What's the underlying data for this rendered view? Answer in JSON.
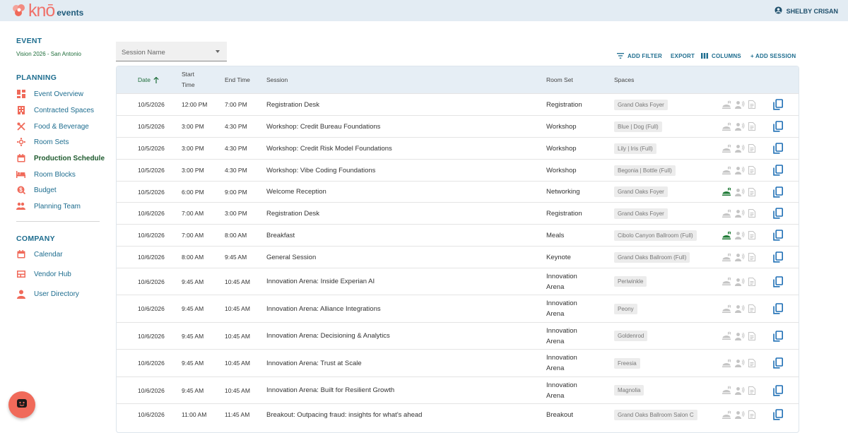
{
  "app": {
    "logo_main": "knō",
    "logo_sub": "events",
    "user_name": "SHELBY CRISAN",
    "brand_color": "#f0716a",
    "accent_color": "#1e6d8f"
  },
  "sidebar": {
    "event_title": "EVENT",
    "event_name": "Vision 2026 - San Antonio",
    "planning_title": "PLANNING",
    "planning_items": [
      {
        "label": "Event Overview",
        "icon": "dashboard-icon"
      },
      {
        "label": "Contracted Spaces",
        "icon": "building-icon"
      },
      {
        "label": "Food & Beverage",
        "icon": "utensils-icon"
      },
      {
        "label": "Room Sets",
        "icon": "room-set-icon"
      },
      {
        "label": "Production Schedule",
        "icon": "calendar-icon",
        "active": true
      },
      {
        "label": "Room Blocks",
        "icon": "bed-icon"
      },
      {
        "label": "Budget",
        "icon": "budget-icon"
      },
      {
        "label": "Planning Team",
        "icon": "team-icon"
      }
    ],
    "company_title": "COMPANY",
    "company_items": [
      {
        "label": "Calendar",
        "icon": "calendar-icon"
      },
      {
        "label": "Vendor Hub",
        "icon": "vendor-hub-icon"
      },
      {
        "label": "User Directory",
        "icon": "user-icon"
      }
    ]
  },
  "filter": {
    "session_select_placeholder": "Session Name"
  },
  "toolbar": {
    "add_filter": "ADD FILTER",
    "export": "EXPORT",
    "columns": "COLUMNS",
    "add_session": "+ ADD SESSION"
  },
  "table": {
    "headers": {
      "date": "Date",
      "start_time_1": "Start",
      "start_time_2": "Time",
      "end_time": "End Time",
      "session": "Session",
      "room_set": "Room Set",
      "spaces": "Spaces"
    },
    "rows": [
      {
        "date": "10/5/2026",
        "start": "12:00 PM",
        "end": "7:00 PM",
        "session": "Registration Desk",
        "room_set": "Registration",
        "space": "Grand Oaks Foyer",
        "fb_active": false
      },
      {
        "date": "10/5/2026",
        "start": "3:00 PM",
        "end": "4:30 PM",
        "session": "Workshop: Credit Bureau Foundations",
        "room_set": "Workshop",
        "space": "Blue | Dog (Full)",
        "fb_active": false
      },
      {
        "date": "10/5/2026",
        "start": "3:00 PM",
        "end": "4:30 PM",
        "session": "Workshop: Credit Risk Model Foundations",
        "room_set": "Workshop",
        "space": "Lily | Iris (Full)",
        "fb_active": false
      },
      {
        "date": "10/5/2026",
        "start": "3:00 PM",
        "end": "4:30 PM",
        "session": "Workshop: Vibe Coding Foundations",
        "room_set": "Workshop",
        "space": "Begonia | Bottle (Full)",
        "fb_active": false
      },
      {
        "date": "10/5/2026",
        "start": "6:00 PM",
        "end": "9:00 PM",
        "session": "Welcome Reception",
        "room_set": "Networking",
        "space": "Grand Oaks Foyer",
        "fb_active": true
      },
      {
        "date": "10/6/2026",
        "start": "7:00 AM",
        "end": "3:00 PM",
        "session": "Registration Desk",
        "room_set": "Registration",
        "space": "Grand Oaks Foyer",
        "fb_active": false
      },
      {
        "date": "10/6/2026",
        "start": "7:00 AM",
        "end": "8:00 AM",
        "session": "Breakfast",
        "room_set": "Meals",
        "space": "Cibolo Canyon Ballroom (Full)",
        "fb_active": true
      },
      {
        "date": "10/6/2026",
        "start": "8:00 AM",
        "end": "9:45 AM",
        "session": "General Session",
        "room_set": "Keynote",
        "space": "Grand Oaks Ballroom (Full)",
        "fb_active": false
      },
      {
        "date": "10/6/2026",
        "start": "9:45 AM",
        "end": "10:45 AM",
        "session": "Innovation Arena: Inside Experian AI",
        "room_set": "Innovation Arena",
        "room_set_1": "Innovation",
        "room_set_2": "Arena",
        "space": "Periwinkle",
        "fb_active": false
      },
      {
        "date": "10/6/2026",
        "start": "9:45 AM",
        "end": "10:45 AM",
        "session": "Innovation Arena: Alliance Integrations",
        "room_set": "Innovation Arena",
        "room_set_1": "Innovation",
        "room_set_2": "Arena",
        "space": "Peony",
        "fb_active": false
      },
      {
        "date": "10/6/2026",
        "start": "9:45 AM",
        "end": "10:45 AM",
        "session": "Innovation Arena: Decisioning & Analytics",
        "room_set": "Innovation Arena",
        "room_set_1": "Innovation",
        "room_set_2": "Arena",
        "space": "Goldenrod",
        "fb_active": false
      },
      {
        "date": "10/6/2026",
        "start": "9:45 AM",
        "end": "10:45 AM",
        "session": "Innovation Arena: Trust at Scale",
        "room_set": "Innovation Arena",
        "room_set_1": "Innovation",
        "room_set_2": "Arena",
        "space": "Freesia",
        "fb_active": false
      },
      {
        "date": "10/6/2026",
        "start": "9:45 AM",
        "end": "10:45 AM",
        "session": "Innovation Arena: Built for Resilient Growth",
        "room_set": "Innovation Arena",
        "room_set_1": "Innovation",
        "room_set_2": "Arena",
        "space": "Magnolia",
        "fb_active": false
      },
      {
        "date": "10/6/2026",
        "start": "11:00 AM",
        "end": "11:45 AM",
        "session": "Breakout: Outpacing fraud: insights for what's ahead",
        "room_set": "Breakout",
        "space": "Grand Oaks Ballroom Salon C",
        "fb_active": false
      }
    ]
  }
}
